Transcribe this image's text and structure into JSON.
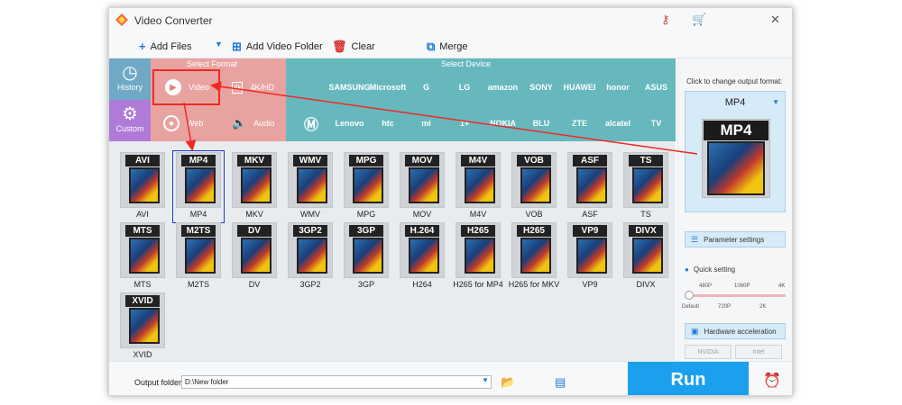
{
  "window": {
    "title": "Video Converter"
  },
  "titlebar_icons": [
    "key-icon",
    "cart-icon",
    "close-icon"
  ],
  "toolbar": {
    "add_files": "Add Files",
    "add_video_folder": "Add Video Folder",
    "clear": "Clear",
    "merge": "Merge"
  },
  "categories": {
    "history": "History",
    "custom": "Custom",
    "select_format": "Select Format",
    "select_device": "Select Device",
    "video": "Video",
    "hd": "4K/HD",
    "web": "Web",
    "audio": "Audio"
  },
  "devices": {
    "row1": [
      "",
      "SAMSUNG",
      "Microsoft",
      "G",
      "LG",
      "amazon",
      "SONY",
      "HUAWEI",
      "honor",
      "ASUS"
    ],
    "row2": [
      "",
      "Lenovo",
      "htc",
      "mi",
      "1+",
      "NOKIA",
      "BLU",
      "ZTE",
      "alcatel",
      "TV"
    ]
  },
  "formats": [
    {
      "badge": "AVI",
      "label": "AVI"
    },
    {
      "badge": "MP4",
      "label": "MP4"
    },
    {
      "badge": "MKV",
      "label": "MKV"
    },
    {
      "badge": "WMV",
      "label": "WMV"
    },
    {
      "badge": "MPG",
      "label": "MPG"
    },
    {
      "badge": "MOV",
      "label": "MOV"
    },
    {
      "badge": "M4V",
      "label": "M4V"
    },
    {
      "badge": "VOB",
      "label": "VOB"
    },
    {
      "badge": "ASF",
      "label": "ASF"
    },
    {
      "badge": "TS",
      "label": "TS"
    },
    {
      "badge": "MTS",
      "label": "MTS"
    },
    {
      "badge": "M2TS",
      "label": "M2TS"
    },
    {
      "badge": "DV",
      "label": "DV"
    },
    {
      "badge": "3GP2",
      "label": "3GP2"
    },
    {
      "badge": "3GP",
      "label": "3GP"
    },
    {
      "badge": "H.264",
      "label": "H264"
    },
    {
      "badge": "H265",
      "label": "H265 for MP4"
    },
    {
      "badge": "H265",
      "label": "H265 for MKV"
    },
    {
      "badge": "VP9",
      "label": "VP9"
    },
    {
      "badge": "DIVX",
      "label": "DIVX"
    },
    {
      "badge": "XVID",
      "label": "XVID"
    }
  ],
  "right_panel": {
    "click_text": "Click to change output format:",
    "selected": "MP4",
    "parameter_settings": "Parameter settings",
    "quick_setting": "Quick setting",
    "ticks_top": [
      "480P",
      "1080P",
      "4K"
    ],
    "ticks_bottom": [
      "Default",
      "720P",
      "2K"
    ],
    "quick_level": 0,
    "hardware_acceleration": "Hardware acceleration",
    "nvidia": "NVIDIA",
    "intel": "Intel"
  },
  "bottom": {
    "output_folder_label": "Output folder:",
    "output_folder_value": "D:\\New folder",
    "run": "Run"
  },
  "colors": {
    "format_area": "#e8a3a0",
    "device_area": "#66b8bd",
    "history": "#6fa9c6",
    "custom": "#b07bd8",
    "run": "#1ba0ee",
    "annotation": "#ee2a24"
  }
}
